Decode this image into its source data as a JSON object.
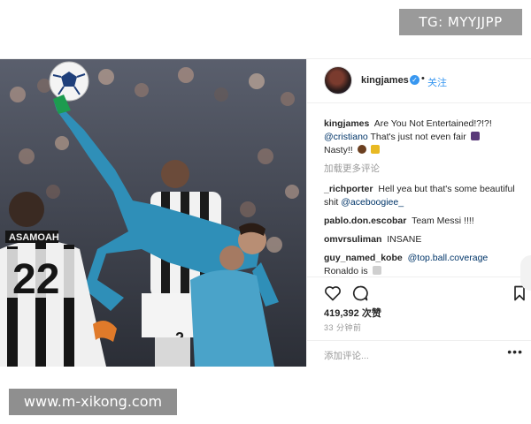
{
  "watermarks": {
    "top": "TG: MYYJJPP",
    "bottom": "www.m-xikong.com"
  },
  "post": {
    "photo": {
      "player_number": "22",
      "player_name": "ASAMOAH",
      "near_number": "2"
    },
    "header": {
      "username": "kingjames",
      "separator": "•",
      "follow_label": "关注",
      "verified_icon": "check-badge-icon"
    },
    "caption": {
      "username": "kingjames",
      "text_1": "Are You Not Entertained!?!?!",
      "mention": "@cristiano",
      "text_2": "That's just not even fair",
      "text_3": "Nasty!!"
    },
    "load_more": "加载更多评论",
    "comments": [
      {
        "user": "_richporter",
        "text": "Hell yea but that's some beautiful shit",
        "mention": "@aceboogiee_"
      },
      {
        "user": "pablo.don.escobar",
        "text": "Team Messi !!!!",
        "mention": ""
      },
      {
        "user": "omvrsuliman",
        "text": "INSANE",
        "mention": ""
      },
      {
        "user": "guy_named_kobe",
        "text": "Ronaldo is",
        "mention": "@top.ball.coverage"
      }
    ],
    "likes": "419,392 次赞",
    "time": "33 分钟前",
    "add_comment_placeholder": "添加评论...",
    "more_label": "•••",
    "colors": {
      "link": "#3897f0",
      "mention": "#003569",
      "muted": "#999999",
      "jersey_blue": "#2f8fb8"
    }
  }
}
